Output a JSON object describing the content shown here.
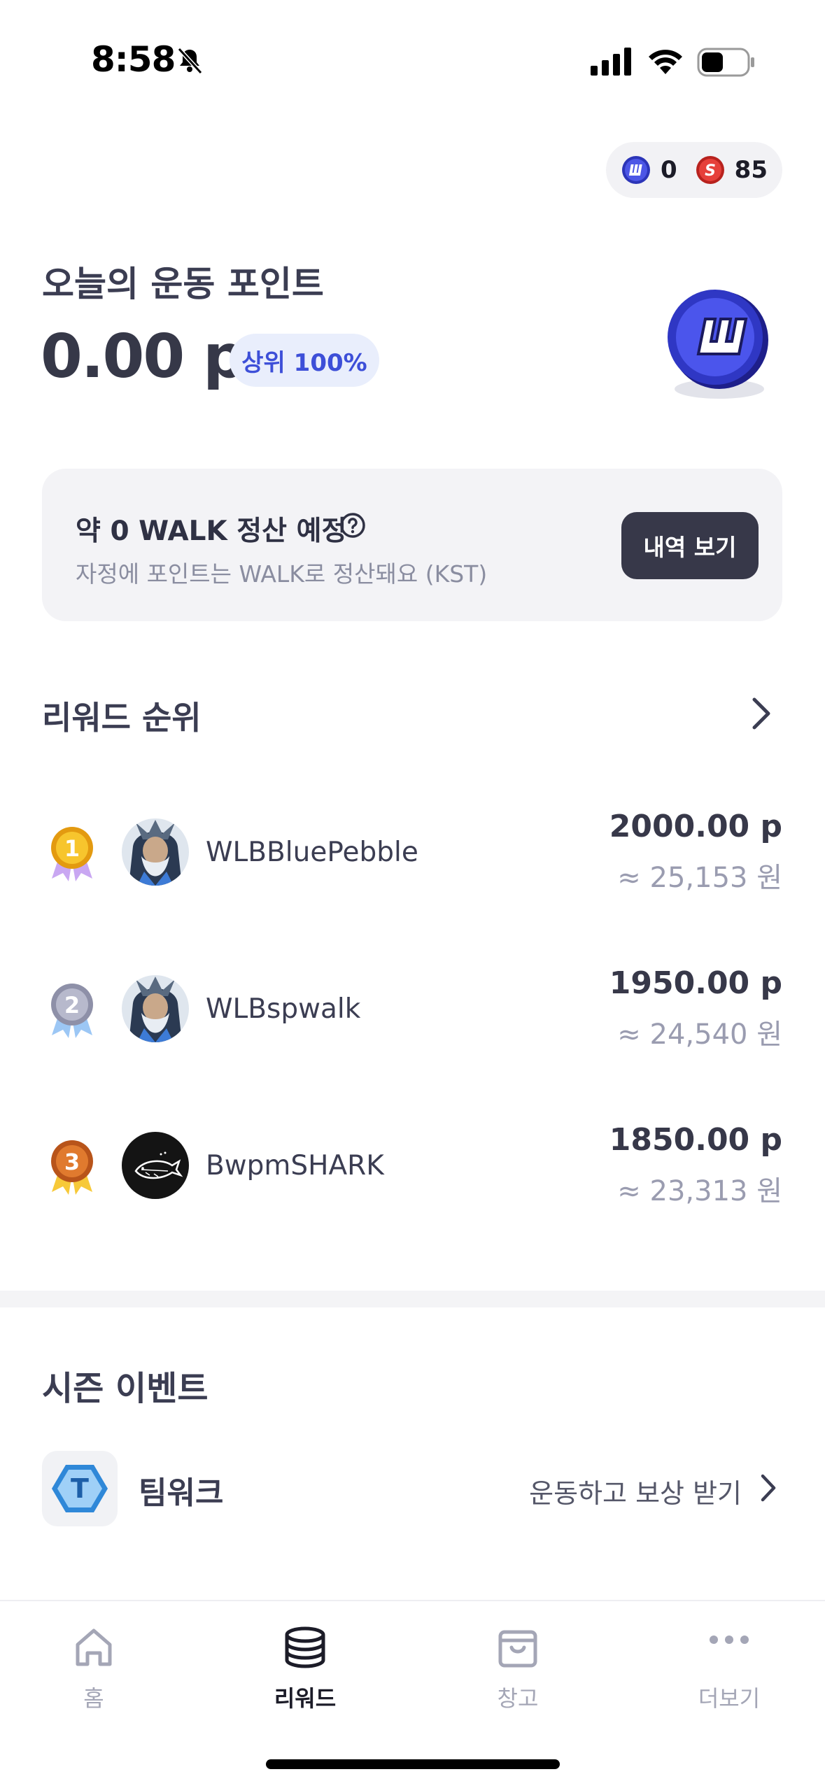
{
  "status_bar": {
    "time": "8:58"
  },
  "tokens": [
    {
      "icon": "walk-coin-icon",
      "letter": "W",
      "count": "0",
      "color": "#3d47d6"
    },
    {
      "icon": "s-coin-icon",
      "letter": "S",
      "count": "85",
      "color": "#e0322d"
    }
  ],
  "today": {
    "title": "오늘의 운동 포인트",
    "points": "0.00 p",
    "rank_chip": "상위 100%"
  },
  "settlement": {
    "title": "약 0 WALK 정산 예정",
    "subtitle": "자정에 포인트는 WALK로 정산돼요 (KST)",
    "history_button": "내역 보기"
  },
  "ranking": {
    "title": "리워드 순위",
    "rows": [
      {
        "rank": "1",
        "name": "WLBBluePebble",
        "points": "2000.00 p",
        "krw": "≈ 25,153 원"
      },
      {
        "rank": "2",
        "name": "WLBspwalk",
        "points": "1950.00 p",
        "krw": "≈ 24,540 원"
      },
      {
        "rank": "3",
        "name": "BwpmSHARK",
        "points": "1850.00 p",
        "krw": "≈ 23,313 원"
      }
    ]
  },
  "season": {
    "title": "시즌 이벤트",
    "event": {
      "name": "팀워크",
      "icon_letter": "T",
      "cta": "운동하고 보상 받기"
    }
  },
  "tabs": [
    {
      "label": "홈",
      "icon": "home-icon",
      "active": false
    },
    {
      "label": "리워드",
      "icon": "coins-icon",
      "active": true
    },
    {
      "label": "창고",
      "icon": "storage-box-icon",
      "active": false
    },
    {
      "label": "더보기",
      "icon": "more-dots-icon",
      "active": false
    }
  ],
  "colors": {
    "accent": "#3d4fd8",
    "dark_button": "#373849",
    "card_bg": "#f3f3f6"
  }
}
